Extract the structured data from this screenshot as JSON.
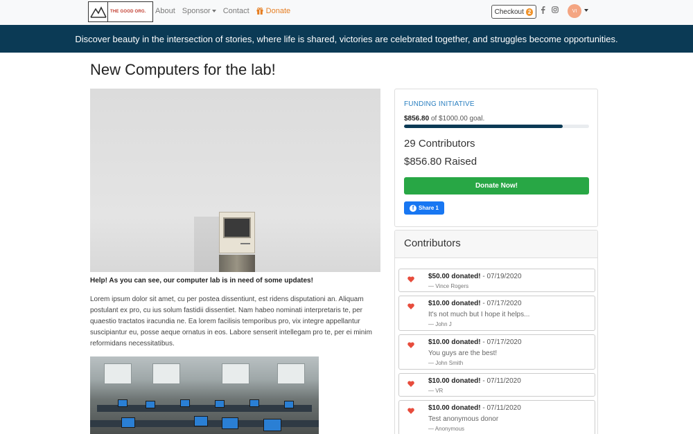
{
  "nav": {
    "logo_text": "THE GOOD ORG.",
    "links": {
      "about": "About",
      "sponsor": "Sponsor",
      "contact": "Contact",
      "donate": "Donate"
    },
    "checkout_label": "Checkout",
    "checkout_count": "2",
    "avatar_initials": "VI",
    "accent_color": "#e67e22"
  },
  "banner": {
    "text": "Discover beauty in the intersection of stories, where life is shared, victories are celebrated together, and struggles become opportunities."
  },
  "page": {
    "title": "New Computers for the lab!",
    "help_text": "Help! As you can see, our computer lab is in need of some updates!",
    "body": "Lorem ipsum dolor sit amet, cu per postea dissentiunt, est ridens disputationi an. Aliquam postulant ex pro, cu ius solum fastidii dissentiet. Nam habeo nominati interpretaris te, per quaestio tractatos iracundia ne. Ea lorem facilisis temporibus pro, vix integre appellantur suscipiantur eu, posse aeque ornatus in eos. Labore senserit intellegam pro te, per ei minim reformidans necessitatibus."
  },
  "funding": {
    "label": "FUNDING INITIATIVE",
    "raised_amount": "$856.80",
    "goal_text": "of $1000.00 goal.",
    "progress_fraction": 0.8568,
    "contributors": "29 Contributors",
    "raised": "$856.80 Raised",
    "donate_button": "Donate Now!",
    "share_button": "Share 1",
    "bar_color": "#0b3a55",
    "button_color": "#28a745"
  },
  "contributors_panel": {
    "title": "Contributors",
    "donations": [
      {
        "amount": "$50.00 donated!",
        "date": " - 07/19/2020",
        "message": "",
        "name": "— Vince Rogers"
      },
      {
        "amount": "$10.00 donated!",
        "date": " - 07/17/2020",
        "message": "It's not much but I hope it helps...",
        "name": "— John J"
      },
      {
        "amount": "$10.00 donated!",
        "date": " - 07/17/2020",
        "message": "You guys are the best!",
        "name": "— John Smith"
      },
      {
        "amount": "$10.00 donated!",
        "date": " - 07/11/2020",
        "message": "",
        "name": "— VR"
      },
      {
        "amount": "$10.00 donated!",
        "date": " - 07/11/2020",
        "message": "Test anonymous donor",
        "name": "— Anonymous"
      }
    ]
  }
}
